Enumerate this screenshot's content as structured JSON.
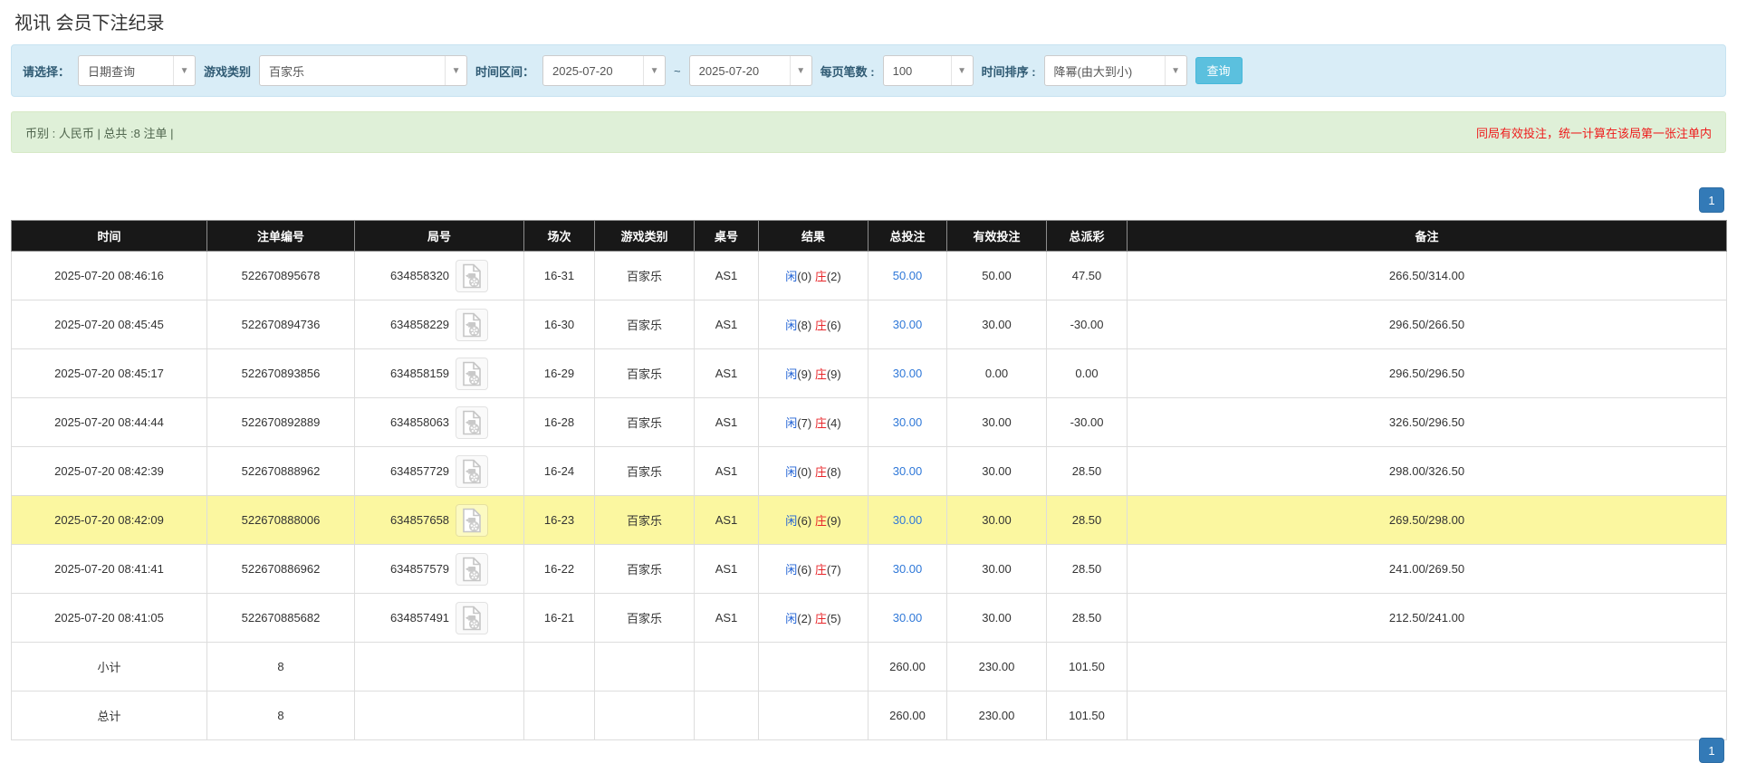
{
  "page_title": "视讯 会员下注纪录",
  "filters": {
    "query_type_label": "请选择：",
    "query_type_value": "日期查询",
    "game_category_label": "游戏类别",
    "game_category_value": "百家乐",
    "time_range_label": "时间区间：",
    "date_from": "2025-07-20",
    "tilde": "~",
    "date_to": "2025-07-20",
    "page_size_label": "每页笔数 :",
    "page_size_value": "100",
    "sort_label": "时间排序 :",
    "sort_value": "降幂(由大到小)",
    "search_button": "查询"
  },
  "summary": {
    "left_text": "币别 : 人民币 | 总共 :8 注单 |",
    "right_notice": "同局有效投注，统一计算在该局第一张注单内"
  },
  "pagination": {
    "page": "1"
  },
  "table": {
    "headers": [
      "时间",
      "注单编号",
      "局号",
      "场次",
      "游戏类别",
      "桌号",
      "结果",
      "总投注",
      "有效投注",
      "总派彩",
      "备注"
    ],
    "rows": [
      {
        "time": "2025-07-20 08:46:16",
        "bet_no": "522670895678",
        "round_no": "634858320",
        "session": "16-31",
        "game": "百家乐",
        "table_no": "AS1",
        "player": "闲",
        "player_pts": "(0)",
        "banker": "庄",
        "banker_pts": "(2)",
        "total_bet": "50.00",
        "valid_bet": "50.00",
        "payout": "47.50",
        "remark": "266.50/314.00"
      },
      {
        "time": "2025-07-20 08:45:45",
        "bet_no": "522670894736",
        "round_no": "634858229",
        "session": "16-30",
        "game": "百家乐",
        "table_no": "AS1",
        "player": "闲",
        "player_pts": "(8)",
        "banker": "庄",
        "banker_pts": "(6)",
        "total_bet": "30.00",
        "valid_bet": "30.00",
        "payout": "-30.00",
        "remark": "296.50/266.50"
      },
      {
        "time": "2025-07-20 08:45:17",
        "bet_no": "522670893856",
        "round_no": "634858159",
        "session": "16-29",
        "game": "百家乐",
        "table_no": "AS1",
        "player": "闲",
        "player_pts": "(9)",
        "banker": "庄",
        "banker_pts": "(9)",
        "total_bet": "30.00",
        "valid_bet": "0.00",
        "payout": "0.00",
        "remark": "296.50/296.50"
      },
      {
        "time": "2025-07-20 08:44:44",
        "bet_no": "522670892889",
        "round_no": "634858063",
        "session": "16-28",
        "game": "百家乐",
        "table_no": "AS1",
        "player": "闲",
        "player_pts": "(7)",
        "banker": "庄",
        "banker_pts": "(4)",
        "total_bet": "30.00",
        "valid_bet": "30.00",
        "payout": "-30.00",
        "remark": "326.50/296.50"
      },
      {
        "time": "2025-07-20 08:42:39",
        "bet_no": "522670888962",
        "round_no": "634857729",
        "session": "16-24",
        "game": "百家乐",
        "table_no": "AS1",
        "player": "闲",
        "player_pts": "(0)",
        "banker": "庄",
        "banker_pts": "(8)",
        "total_bet": "30.00",
        "valid_bet": "30.00",
        "payout": "28.50",
        "remark": "298.00/326.50"
      },
      {
        "time": "2025-07-20 08:42:09",
        "bet_no": "522670888006",
        "round_no": "634857658",
        "session": "16-23",
        "game": "百家乐",
        "table_no": "AS1",
        "player": "闲",
        "player_pts": "(6)",
        "banker": "庄",
        "banker_pts": "(9)",
        "total_bet": "30.00",
        "valid_bet": "30.00",
        "payout": "28.50",
        "remark": "269.50/298.00"
      },
      {
        "time": "2025-07-20 08:41:41",
        "bet_no": "522670886962",
        "round_no": "634857579",
        "session": "16-22",
        "game": "百家乐",
        "table_no": "AS1",
        "player": "闲",
        "player_pts": "(6)",
        "banker": "庄",
        "banker_pts": "(7)",
        "total_bet": "30.00",
        "valid_bet": "30.00",
        "payout": "28.50",
        "remark": "241.00/269.50"
      },
      {
        "time": "2025-07-20 08:41:05",
        "bet_no": "522670885682",
        "round_no": "634857491",
        "session": "16-21",
        "game": "百家乐",
        "table_no": "AS1",
        "player": "闲",
        "player_pts": "(2)",
        "banker": "庄",
        "banker_pts": "(5)",
        "total_bet": "30.00",
        "valid_bet": "30.00",
        "payout": "28.50",
        "remark": "212.50/241.00"
      }
    ],
    "footer": [
      {
        "label": "小计",
        "count": "8",
        "total_bet": "260.00",
        "valid_bet": "230.00",
        "payout": "101.50"
      },
      {
        "label": "总计",
        "count": "8",
        "total_bet": "260.00",
        "valid_bet": "230.00",
        "payout": "101.50"
      }
    ]
  },
  "colors": {
    "accent_blue": "#337ab7",
    "info_bg": "#d9edf7",
    "success_bg": "#dff0d8",
    "link_blue": "#2f78d8",
    "player_blue": "#2263d5",
    "banker_red": "#e8262a",
    "negative_red": "#ff0000",
    "highlight_yellow": "#fbf7a0",
    "header_black": "#181818",
    "footer_gray": "#9d9d9d",
    "button_cyan": "#5bc0de",
    "notice_red": "#ee1c1c"
  }
}
